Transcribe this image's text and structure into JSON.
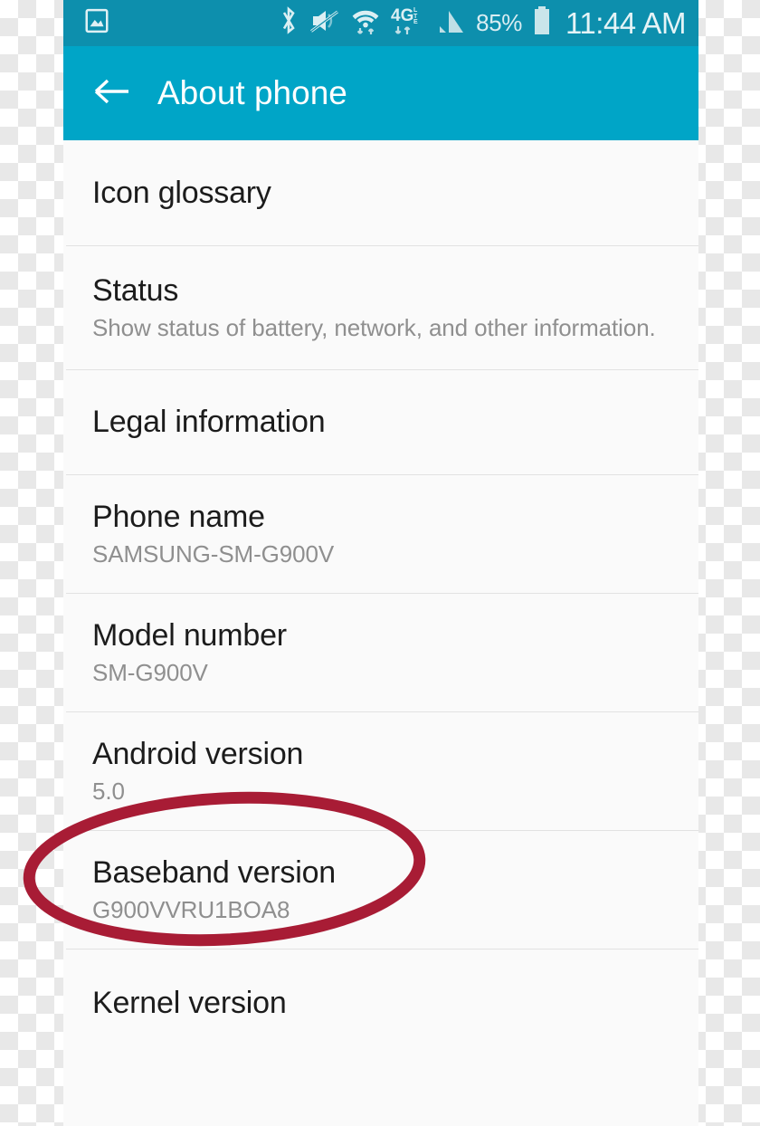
{
  "status_bar": {
    "left_icons": [
      {
        "name": "image-picture-icon",
        "label": "picture"
      }
    ],
    "right_icons": [
      {
        "name": "bluetooth-icon",
        "label": "Bluetooth"
      },
      {
        "name": "mute-vibrate-off-icon",
        "label": "Sound off"
      },
      {
        "name": "wifi-icon",
        "label": "Wi-Fi"
      },
      {
        "name": "4g-lte-icon",
        "label": "4G LTE"
      },
      {
        "name": "cellular-signal-icon",
        "label": "Signal"
      }
    ],
    "battery_percent": "85%",
    "battery_icon": "battery-icon",
    "clock": "11:44 AM"
  },
  "toolbar": {
    "back_icon": "back-arrow-icon",
    "title": "About phone"
  },
  "list": {
    "items": [
      {
        "title": "Icon glossary",
        "sub": ""
      },
      {
        "title": "Status",
        "sub": "Show status of battery, network, and other information."
      },
      {
        "title": "Legal information",
        "sub": ""
      },
      {
        "title": "Phone name",
        "sub": "SAMSUNG-SM-G900V"
      },
      {
        "title": "Model number",
        "sub": "SM-G900V"
      },
      {
        "title": "Android version",
        "sub": "5.0"
      },
      {
        "title": "Baseband version",
        "sub": "G900VVRU1BOA8"
      },
      {
        "title": "Kernel version",
        "sub": ""
      }
    ]
  },
  "annotation": {
    "shape": "ellipse",
    "target": "Android version",
    "color": "#a81c35"
  },
  "colors": {
    "status_bar_bg": "#0d8fad",
    "toolbar_bg": "#00a5c7",
    "list_bg": "#fafafa",
    "divider": "#e2e2e2",
    "title_text": "#1c1c1c",
    "sub_text": "#8f8f8f",
    "annotation_red": "#a81c35"
  }
}
